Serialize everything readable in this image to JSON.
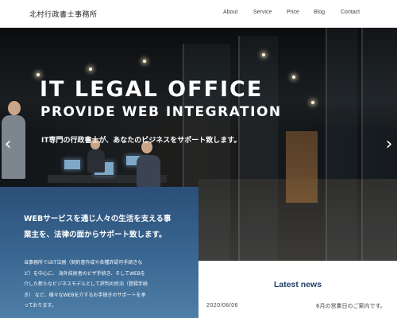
{
  "header": {
    "logo": "北村行政書士事務所",
    "nav": [
      "About",
      "Service",
      "Price",
      "Blog",
      "Contact"
    ]
  },
  "hero": {
    "title": "IT LEGAL OFFICE",
    "subtitle": "PROVIDE WEB INTEGRATION",
    "tagline": "IT専門の行政書士が、あなたのビジネスをサポート致します。",
    "prev_icon": "chevron-left-icon",
    "next_icon": "chevron-right-icon",
    "prev_glyph": "‹",
    "next_glyph": "›"
  },
  "info": {
    "heading_line1": "WEBサービスを通じ人々の生活を支える事",
    "heading_line2": "業主を、法律の面からサポート致します。",
    "body_lines": [
      "当事務所ではIT法務（契約書作成や各種許認可手続きな",
      "ど）を中心に、 海外技術者のビザ手続き、そしてWEBを",
      "介した新たなビジネスモデルとして評判の民泊（登録手続",
      "き） など、様々なWEBを介するお手続きのサポートを承",
      "っております。"
    ]
  },
  "news": {
    "title": "Latest news",
    "items": [
      {
        "date": "2020/06/06",
        "text": "6月の営業日のご案内です。"
      }
    ]
  },
  "colors": {
    "panel_top": "#2b4f78",
    "panel_bottom": "#4e7ea6",
    "news_title": "#23406a"
  }
}
